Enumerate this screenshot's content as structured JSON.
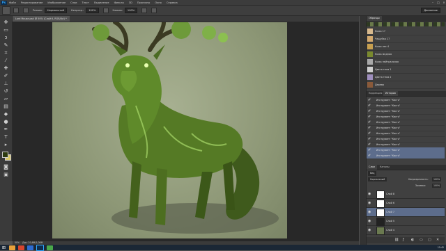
{
  "menubar": {
    "items": [
      "Файл",
      "Редактирование",
      "Изображение",
      "Слои",
      "Текст",
      "Выделение",
      "Фильтр",
      "3D",
      "Просмотр",
      "Окно",
      "Справка"
    ],
    "logo": "Ps"
  },
  "options": {
    "size_label": "Режим:",
    "mode_value": "Нормальный",
    "opacity_label": "Непрозр.:",
    "opacity_value": "100%",
    "flow_label": "Нажим:",
    "flow_value": "100%",
    "workspace_value": "Движение"
  },
  "document": {
    "tab_title": "Lord Mouse.psd @ 50% (Слой 6, RGB/8#) *"
  },
  "status": {
    "zoom": "50%",
    "doc_info": "Док: 20,6M/1,08M"
  },
  "swatches": {
    "tab_label": "Образцы",
    "rows": [
      {
        "name": "Кожа 17",
        "color": "#d7b98d"
      },
      {
        "name": "Чешуйка 17",
        "color": "#d3a96e"
      },
      {
        "name": "Кожа лес 4",
        "color": "#c8a04f"
      },
      {
        "name": "Кожа медная",
        "color": "#7a8a2e"
      },
      {
        "name": "Кожа нейтральная",
        "color": "#a9a9a9"
      },
      {
        "name": "Цвета тела 1",
        "color": "#cfcfcf"
      },
      {
        "name": "Цвета тела 2",
        "color": "#9f8fbe"
      },
      {
        "name": "Дерево",
        "color": "#8a5a3a"
      }
    ]
  },
  "history": {
    "tabs": [
      "Коррекция",
      "История"
    ],
    "rows": [
      "Инструмент \"Кисть\"",
      "Инструмент \"Кисть\"",
      "Инструмент \"Кисть\"",
      "Инструмент \"Кисть\"",
      "Инструмент \"Кисть\"",
      "Инструмент \"Кисть\"",
      "Инструмент \"Кисть\"",
      "Инструмент \"Кисть\"",
      "Инструмент \"Кисть\"",
      "Инструмент \"Кисть\"",
      "Инструмент \"Кисть\""
    ]
  },
  "layers": {
    "tabs": [
      "Слои",
      "Каналы"
    ],
    "filter_label": "Вид",
    "blend_value": "Нормальный",
    "opacity_label": "Непрозрачность:",
    "opacity_value": "100%",
    "fill_label": "Заливка:",
    "fill_value": "100%",
    "rows": [
      {
        "name": "Слой 8"
      },
      {
        "name": "Слой 6"
      },
      {
        "name": "Слой 7"
      },
      {
        "name": "Слой 5"
      },
      {
        "name": "Слой 4"
      }
    ]
  },
  "taskbar": {
    "time": "15:42"
  }
}
